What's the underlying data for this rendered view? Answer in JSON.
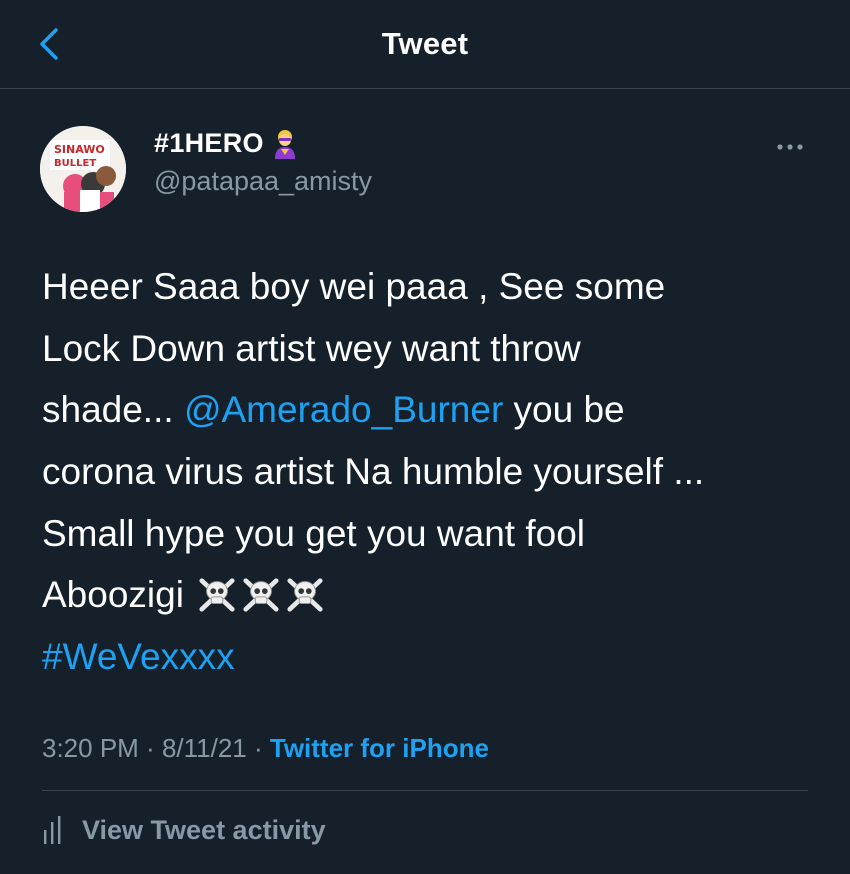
{
  "header": {
    "title": "Tweet"
  },
  "author": {
    "display_name": "#1HERO",
    "handle": "@patapaa_amisty",
    "avatar_text_top": "SINAWO",
    "avatar_text_bottom": "BULLET"
  },
  "tweet": {
    "line1": "Heeer Saaa boy wei paaa , See some",
    "line2": "Lock Down artist wey want throw",
    "line3_before": "shade... ",
    "line3_mention": "@Amerado_Burner",
    "line3_after": " you be",
    "line4": "corona virus artist Na humble yourself ...",
    "line5": "Small hype you get you want fool",
    "line6": "Aboozigi",
    "hashtag": "#WeVexxxx"
  },
  "meta": {
    "time": "3:20 PM",
    "sep1": " · ",
    "date": "8/11/21",
    "sep2": " · ",
    "source": "Twitter for iPhone"
  },
  "activity": {
    "label": "View Tweet activity"
  },
  "colors": {
    "background": "#15202b",
    "accent": "#1da1f2",
    "secondary_text": "#8899a6",
    "divider": "#38444d"
  },
  "icons": [
    "back-chevron-icon",
    "superhero-emoji-icon",
    "more-options-icon",
    "skull-crossbones-icon",
    "activity-bars-icon"
  ]
}
